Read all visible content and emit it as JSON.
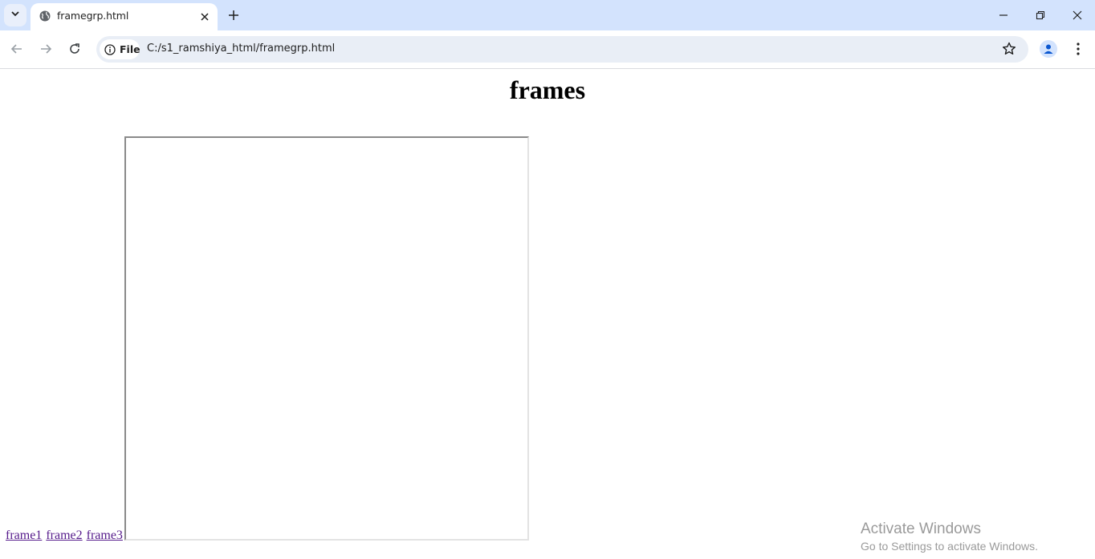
{
  "browser": {
    "tab": {
      "title": "framegrp.html",
      "favicon": "globe-icon"
    },
    "new_tab_icon": "plus-icon",
    "window_controls": [
      "minimize-icon",
      "restore-icon",
      "close-icon"
    ],
    "omnibox": {
      "chip_label": "File",
      "chip_icon": "info-icon",
      "url": "C:/s1_ramshiya_html/framegrp.html"
    }
  },
  "page": {
    "heading": "frames",
    "links": [
      {
        "label": "frame1"
      },
      {
        "label": "frame2"
      },
      {
        "label": "frame3"
      }
    ]
  },
  "watermark": {
    "title": "Activate Windows",
    "subtitle": "Go to Settings to activate Windows."
  },
  "colors": {
    "tabstrip_bg": "#d3e3fd",
    "omnibox_bg": "#e9eef6",
    "visited_link": "#551a8b",
    "profile_accent": "#0b57d0"
  }
}
